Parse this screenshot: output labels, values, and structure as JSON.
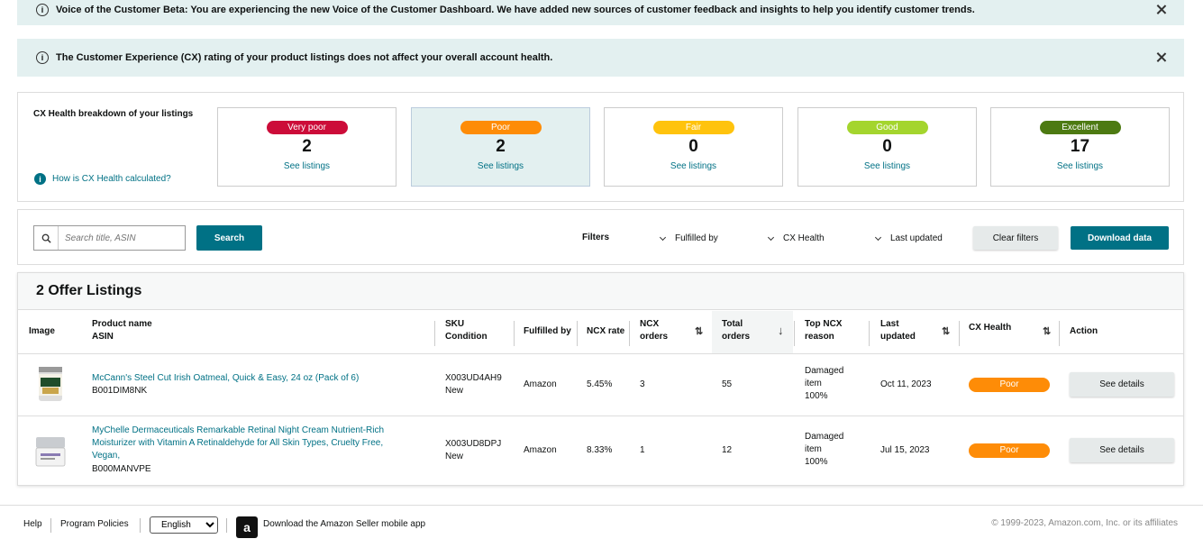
{
  "banners": {
    "beta": "Voice of the Customer Beta: You are experiencing the new Voice of the Customer Dashboard. We have added new sources of customer feedback and insights to help you identify customer trends.",
    "cx_note": "The Customer Experience (CX) rating of your product listings does not affect your overall account health.",
    "info_glyph": "i"
  },
  "health": {
    "title": "CX Health breakdown of your listings",
    "calc_link": "How is CX Health calculated?",
    "cards": [
      {
        "label": "Very poor",
        "count": "2",
        "link": "See listings",
        "color": "#cc0c39"
      },
      {
        "label": "Poor",
        "count": "2",
        "link": "See listings",
        "color": "#fe8c07"
      },
      {
        "label": "Fair",
        "count": "0",
        "link": "See listings",
        "color": "#ffc30d"
      },
      {
        "label": "Good",
        "count": "0",
        "link": "See listings",
        "color": "#a4d52e"
      },
      {
        "label": "Excellent",
        "count": "17",
        "link": "See listings",
        "color": "#4d7a12"
      }
    ]
  },
  "filters": {
    "search_placeholder": "Search title, ASIN",
    "search_button": "Search",
    "label": "Filters",
    "fulfilled_by": "Fulfilled by",
    "cx_health": "CX Health",
    "last_updated": "Last updated",
    "clear": "Clear filters",
    "download": "Download data"
  },
  "listings": {
    "title": "2 Offer Listings",
    "headers": {
      "image": "Image",
      "product_name": "Product name",
      "asin": "ASIN",
      "sku": "SKU",
      "condition": "Condition",
      "fulfilled_by": "Fulfilled by",
      "ncx_rate": "NCX rate",
      "ncx_orders_1": "NCX",
      "ncx_orders_2": "orders",
      "total_orders_1": "Total",
      "total_orders_2": "orders",
      "top_ncx_1": "Top NCX",
      "top_ncx_2": "reason",
      "last_updated_1": "Last",
      "last_updated_2": "updated",
      "cx_health": "CX Health",
      "action": "Action"
    },
    "rows": [
      {
        "title": "McCann's Steel Cut Irish Oatmeal, Quick & Easy, 24 oz (Pack of 6)",
        "asin": "B001DIM8NK",
        "sku": "X003UD4AH9",
        "condition": "New",
        "fulfilled_by": "Amazon",
        "ncx_rate": "5.45%",
        "ncx_orders": "3",
        "total_orders": "55",
        "reason_1": "Damaged",
        "reason_2": "item",
        "reason_pct": "100%",
        "last_updated": "Oct 11, 2023",
        "cx_health": "Poor",
        "action": "See details"
      },
      {
        "title_1": "MyChelle Dermaceuticals Remarkable Retinal Night Cream Nutrient-Rich",
        "title_2": "Moisturizer with Vitamin A Retinaldehyde for All Skin Types, Cruelty Free,",
        "title_3": "Vegan,",
        "asin": "B000MANVPE",
        "sku": "X003UD8DPJ",
        "condition": "New",
        "fulfilled_by": "Amazon",
        "ncx_rate": "8.33%",
        "ncx_orders": "1",
        "total_orders": "12",
        "reason_1": "Damaged",
        "reason_2": "item",
        "reason_pct": "100%",
        "last_updated": "Jul 15, 2023",
        "cx_health": "Poor",
        "action": "See details"
      }
    ]
  },
  "footer": {
    "help": "Help",
    "policies": "Program Policies",
    "language": "English",
    "app_glyph": "a",
    "app": "Download the Amazon Seller mobile app",
    "copyright": "© 1999-2023, Amazon.com, Inc. or its affiliates"
  }
}
